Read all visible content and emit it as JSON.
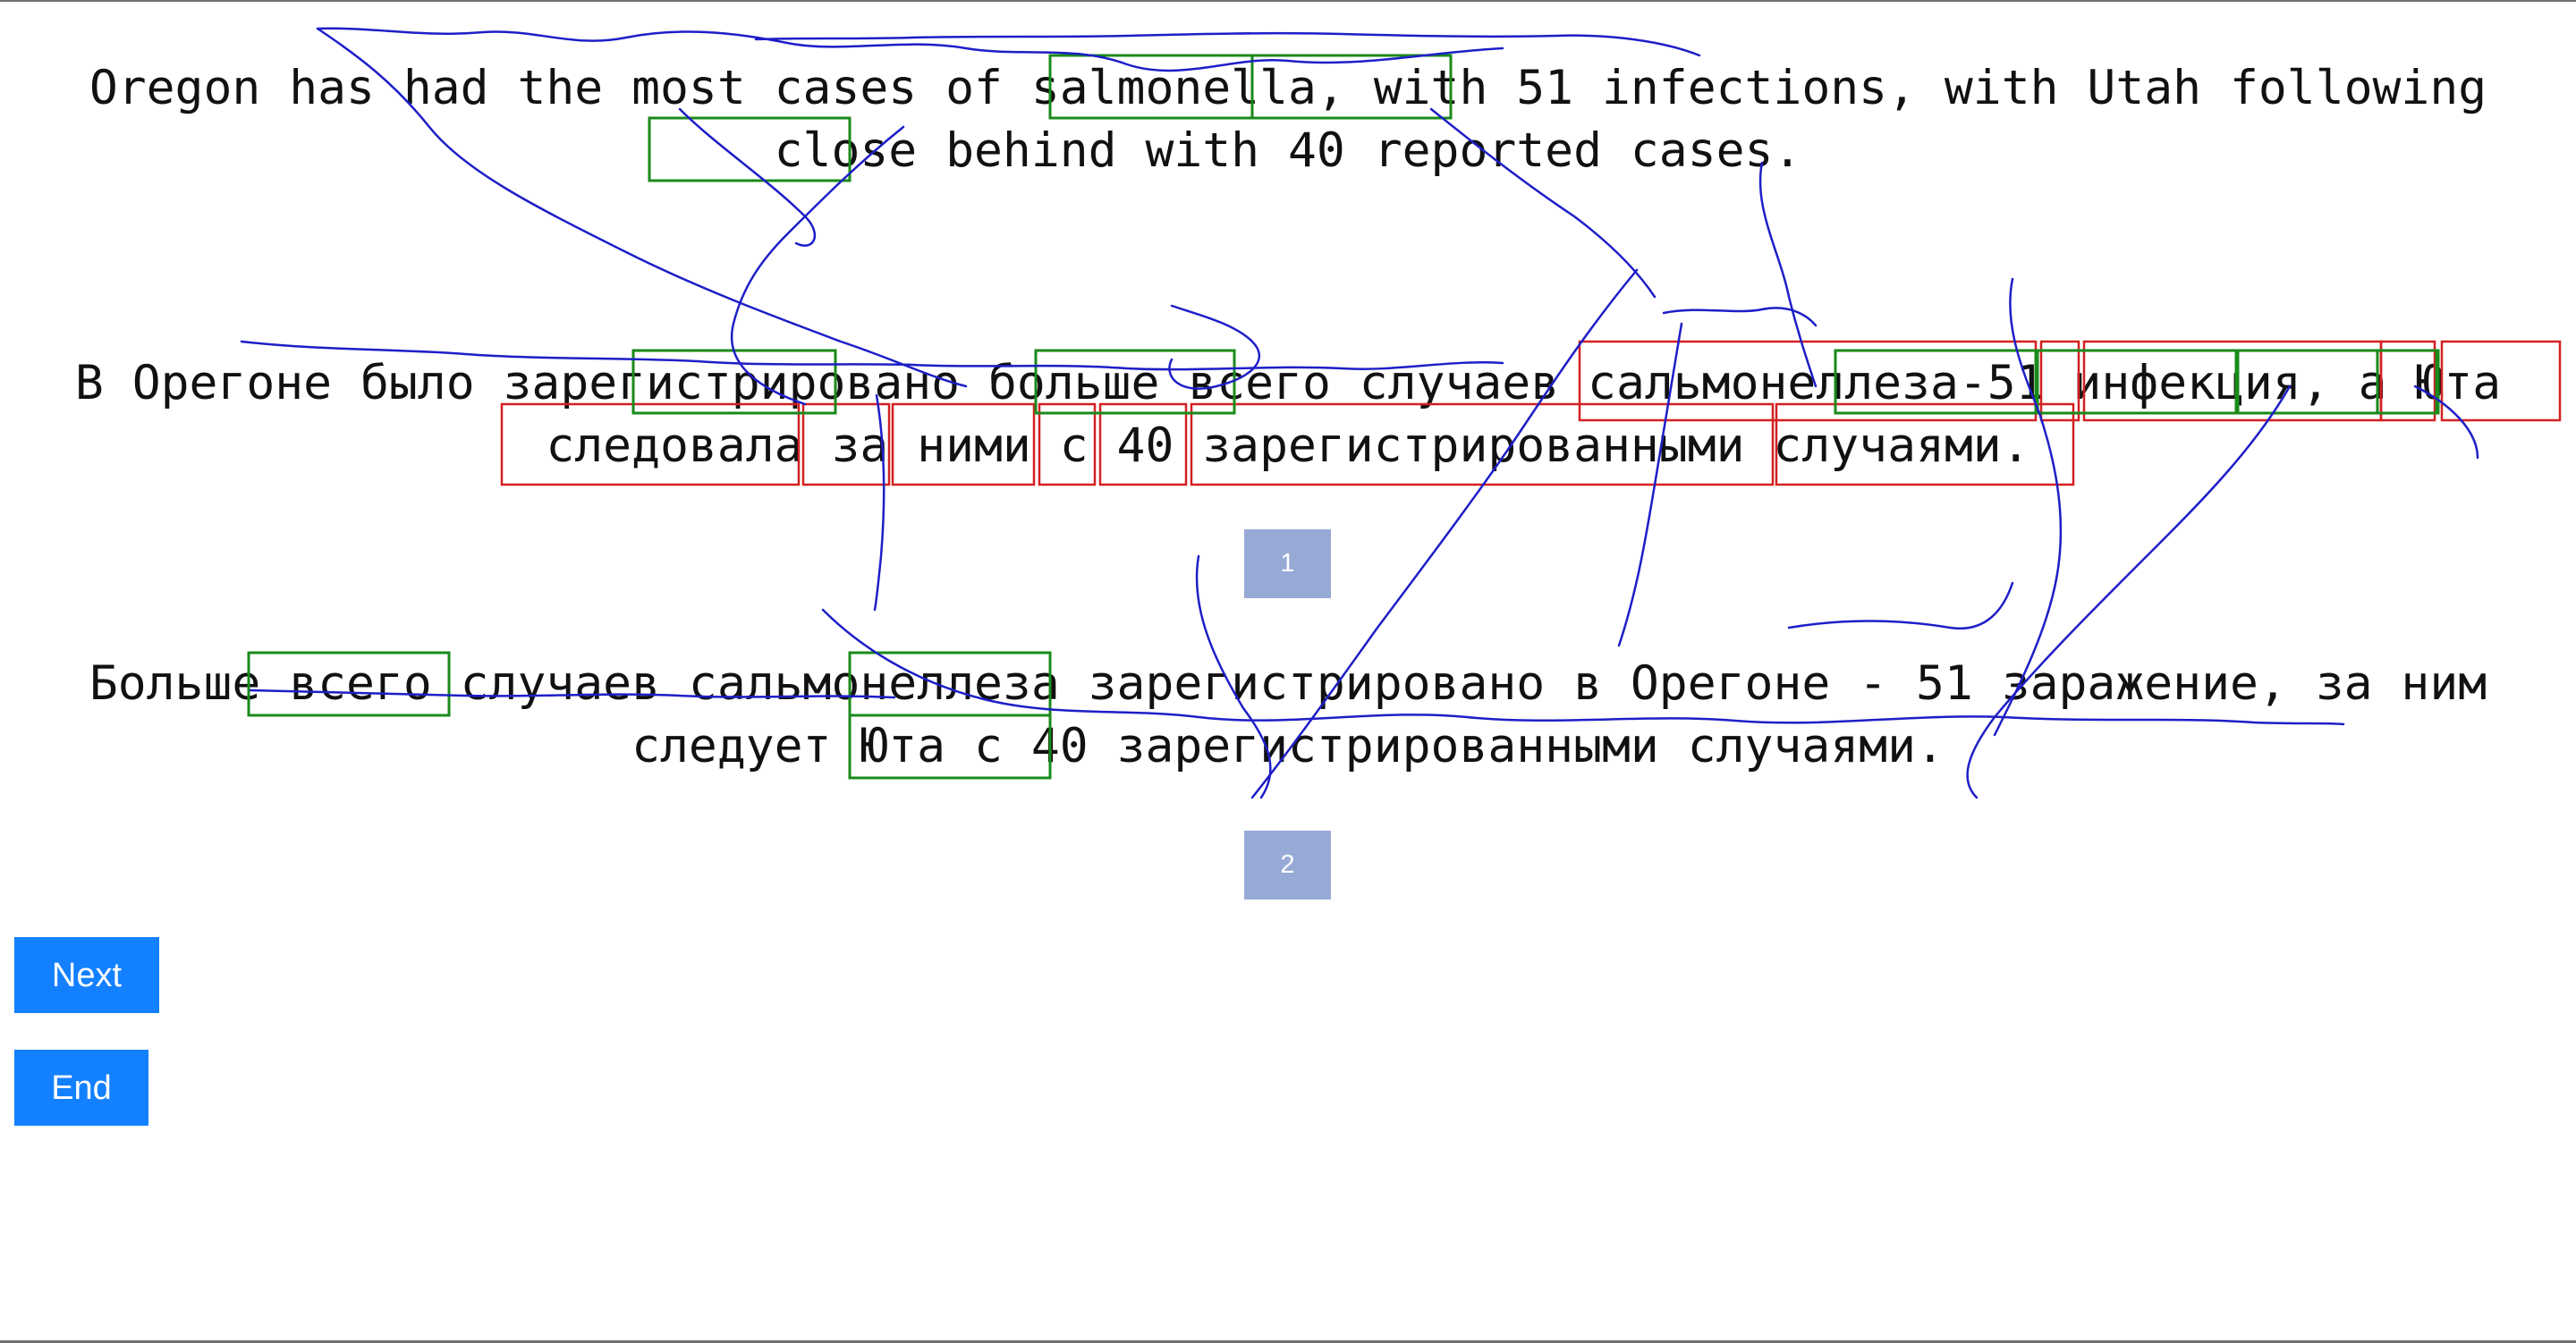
{
  "source": {
    "line1": "Oregon has had the most cases of salmonella, with 51 infections, with Utah following",
    "line2": "close behind with 40 reported cases."
  },
  "candidates": [
    {
      "number": "1",
      "line1": "В Орегоне было зарегистрировано больше всего случаев сальмонеллеза-51 инфекция, а Юта",
      "line2": "следовала за ними с 40 зарегистрированными случаями."
    },
    {
      "number": "2",
      "line1": "Больше всего случаев сальмонеллеза зарегистрировано в Орегоне - 51 заражение, за ним",
      "line2": "следует Юта с 40 зарегистрированными случаями."
    }
  ],
  "buttons": {
    "next_label": "Next",
    "end_label": "End"
  },
  "colors": {
    "page_background": "#ffffff",
    "badge_fill": "#97aad5",
    "button_fill": "#1381ff",
    "stroke_ink": "#1e1ec8",
    "match_box": "#1a8a1a",
    "error_box": "#d42020"
  }
}
